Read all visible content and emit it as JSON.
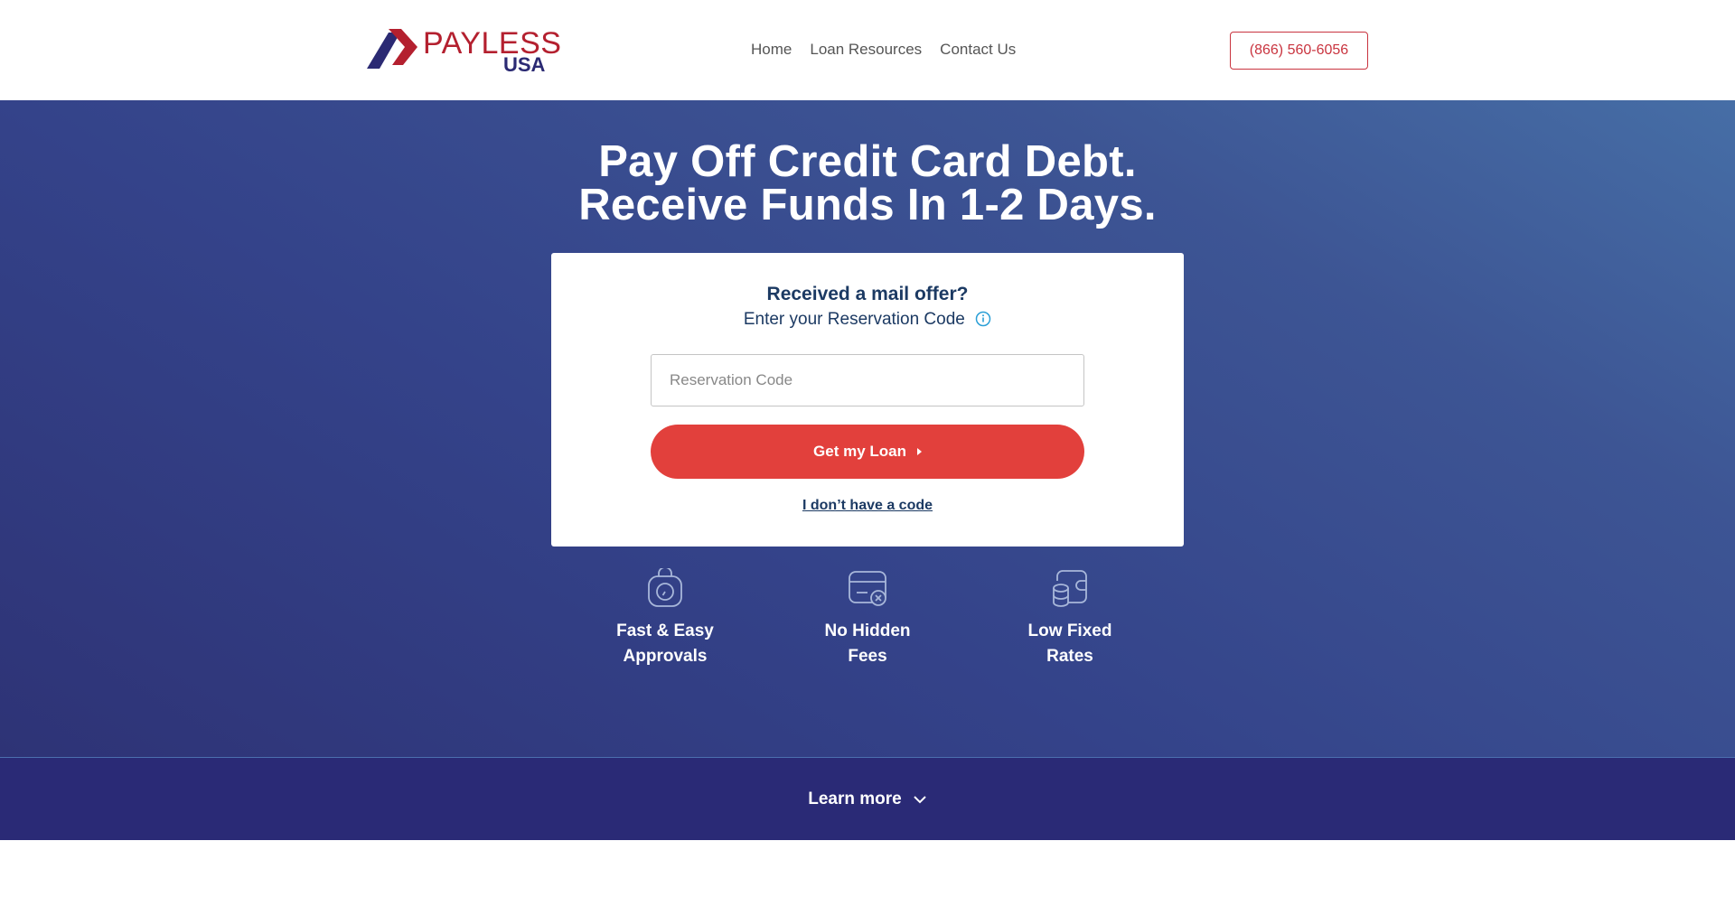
{
  "header": {
    "logo_line1": "PAYLESS",
    "logo_line2": "USA",
    "nav": [
      "Home",
      "Loan Resources",
      "Contact Us"
    ],
    "phone": "(866) 560-6056"
  },
  "hero": {
    "title_line1": "Pay Off Credit Card Debt.",
    "title_line2": "Receive Funds In 1-2 Days."
  },
  "card": {
    "heading": "Received a mail offer?",
    "subheading": "Enter your Reservation Code",
    "input_placeholder": "Reservation Code",
    "input_value": "",
    "button_label": "Get my Loan",
    "no_code_link": "I don’t have a code"
  },
  "features": [
    {
      "line1": "Fast & Easy",
      "line2": "Approvals",
      "icon": "stopwatch-bag-icon"
    },
    {
      "line1": "No Hidden",
      "line2": "Fees",
      "icon": "card-no-fee-icon"
    },
    {
      "line1": "Low Fixed",
      "line2": "Rates",
      "icon": "coins-wallet-icon"
    }
  ],
  "learn_more": {
    "label": "Learn more",
    "icon": "chevron-down-icon"
  },
  "colors": {
    "brand_red": "#b4202f",
    "brand_navy": "#2b2a73",
    "button_red": "#e2403c",
    "hero_blue": "#34438a",
    "bar_navy": "#2a2a76",
    "text_navy": "#1c3a63"
  }
}
